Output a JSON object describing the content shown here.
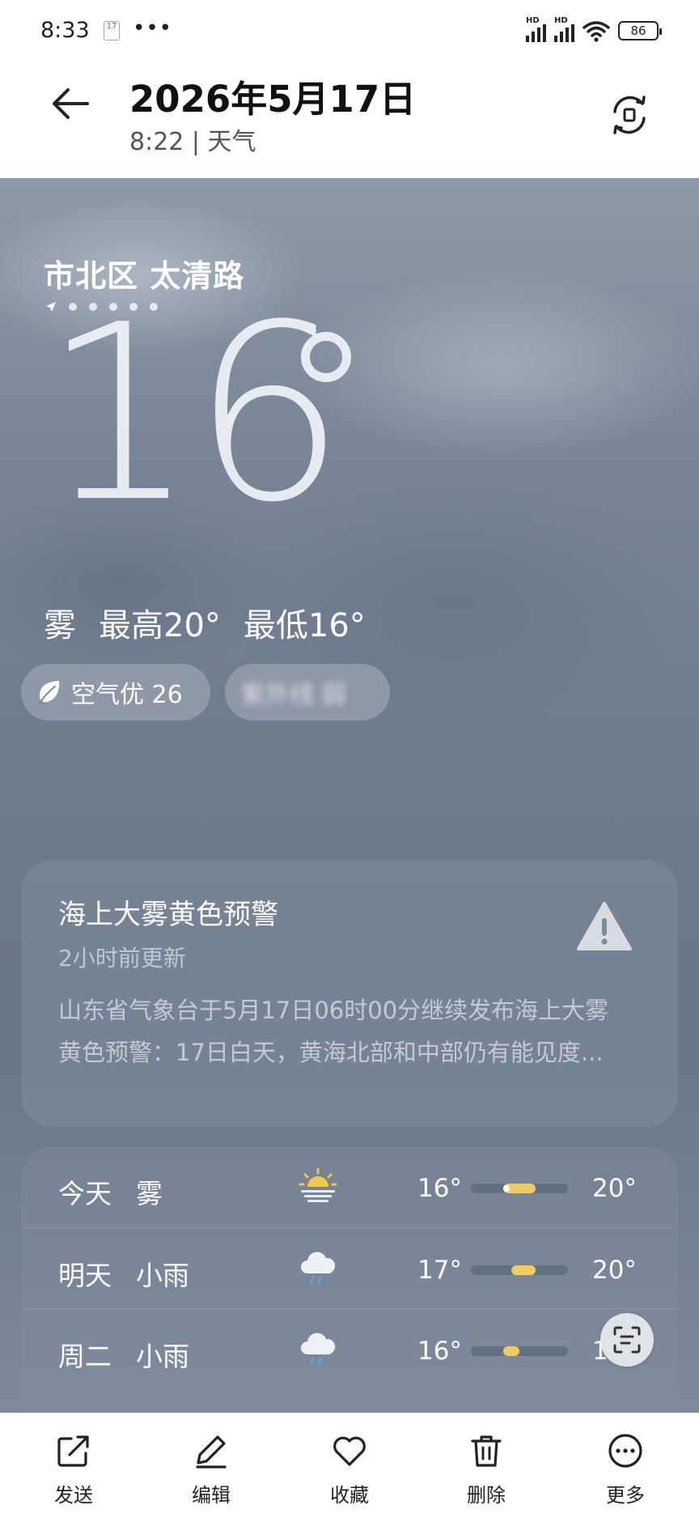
{
  "status_bar": {
    "time": "8:33",
    "calendar_day": "17",
    "overflow": "•••",
    "signal1": "HD",
    "signal2": "HD",
    "battery": "86"
  },
  "header": {
    "title": "2026年5月17日",
    "subtitle": "8:22 | 天气"
  },
  "weather": {
    "location": "市北区 太清路",
    "temperature": "16",
    "condition": "雾",
    "high": "最高20°",
    "low": "最低16°",
    "aqi_label": "空气优 26",
    "blurred_chip": "紫外线 弱"
  },
  "alert": {
    "title": "海上大雾黄色预警",
    "updated": "2小时前更新",
    "line1": "山东省气象台于5月17日06时00分继续发布海上大雾",
    "line2": "黄色预警：17日白天，黄海北部和中部仍有能见度..."
  },
  "forecast": [
    {
      "day": "今天",
      "condition": "雾",
      "icon": "sun-haze-icon",
      "low": "16°",
      "high": "20°",
      "low_value": 16,
      "high_value": 20,
      "current": 16
    },
    {
      "day": "明天",
      "condition": "小雨",
      "icon": "rain-cloud-icon",
      "low": "17°",
      "high": "20°",
      "low_value": 17,
      "high_value": 20
    },
    {
      "day": "周二",
      "condition": "小雨",
      "icon": "rain-cloud-icon",
      "low": "16°",
      "high": "1",
      "low_value": 16,
      "high_value": 18
    }
  ],
  "forecast_scale": {
    "min": 12,
    "max": 24
  },
  "actions": {
    "send": "发送",
    "edit": "编辑",
    "favorite": "收藏",
    "delete": "删除",
    "more": "更多"
  },
  "colors": {
    "accent_bar": "#f1cc62",
    "alert_icon": "#d9dde3"
  }
}
